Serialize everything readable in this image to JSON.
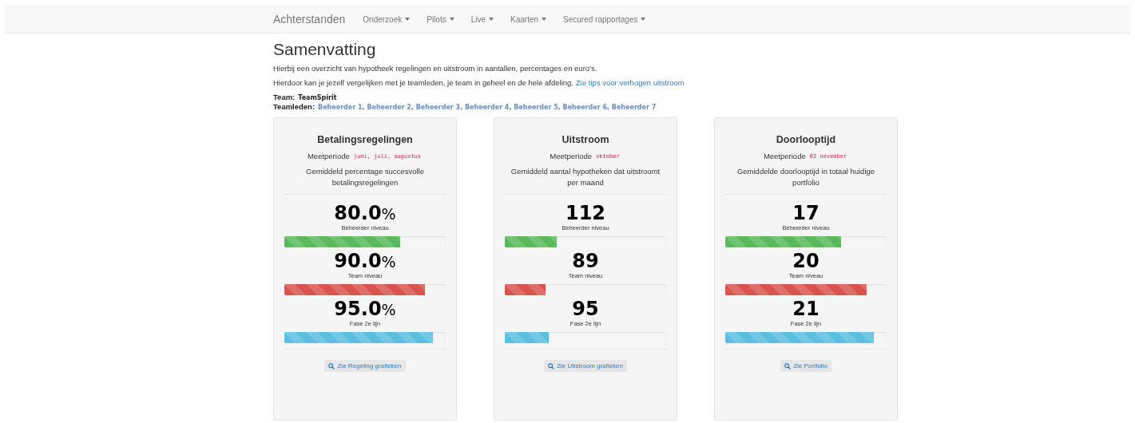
{
  "navbar": {
    "brand": "Achterstanden",
    "menus": [
      {
        "label": "Onderzoek"
      },
      {
        "label": "Pilots"
      },
      {
        "label": "Live"
      },
      {
        "label": "Kaarten"
      },
      {
        "label": "Secured rapportages"
      }
    ]
  },
  "heading": "Samenvatting",
  "intro": "Hierbij een overzicht van hypotheek regelingen en uitstroom in aantallen, percentages en euro's.",
  "compare": {
    "text": "Hierdoor kan je jezelf vergelijken met je teamleden, je team in geheel en de hele afdeling.",
    "link": "Zie tips voor verhogen uitstroom"
  },
  "team": {
    "label": "Team:",
    "value": "TeamSpirit"
  },
  "members": {
    "label": "Teamleden:",
    "value": "Beheerder 1, Beheerder 2, Beheerder 3, Beheerder 4, Beheerder 5, Beheerder 6, Beheerder 7"
  },
  "cards": [
    {
      "title": "Betalingsregelingen",
      "period_label": "Meetperiode",
      "period": "juni, juli, augustus",
      "description": "Gemiddeld percentage succesvolle betalingsregelingen",
      "metrics": [
        {
          "value": "80.0",
          "unit": "%",
          "label": "Beheerder niveau",
          "level": 0.72,
          "color": "#5cb85c"
        },
        {
          "value": "90.0",
          "unit": "%",
          "label": "Team niveau",
          "level": 0.87,
          "color": "#d9534f"
        },
        {
          "value": "95.0",
          "unit": "%",
          "label": "Fase 2e lijn",
          "level": 0.92,
          "color": "#5bc0de"
        }
      ],
      "button": "Zie Regeling grafieken"
    },
    {
      "title": "Uitstroom",
      "period_label": "Meetperiode",
      "period": "oktober",
      "description": "Gemiddeld aantal hypotheken dat uitstroomt per maand",
      "metrics": [
        {
          "value": "112",
          "label": "Beheerder niveau",
          "level": 0.32,
          "color": "#5cb85c"
        },
        {
          "value": "89",
          "label": "Team niveau",
          "level": 0.25,
          "color": "#d9534f"
        },
        {
          "value": "95",
          "label": "Fase 2e lijn",
          "level": 0.27,
          "color": "#5bc0de"
        }
      ],
      "button": "Zie Uitstroom grafieken"
    },
    {
      "title": "Doorlooptijd",
      "period_label": "Meetperiode",
      "period": "02 november",
      "description": "Gemiddelde doorlooptijd in totaal huidige portfolio",
      "metrics": [
        {
          "value": "17",
          "label": "Beheerder niveau",
          "level": 0.72,
          "color": "#5cb85c"
        },
        {
          "value": "20",
          "label": "Team niveau",
          "level": 0.875,
          "color": "#d9534f"
        },
        {
          "value": "21",
          "label": "Fase 2e lijn",
          "level": 0.92,
          "color": "#5bc0de"
        }
      ],
      "button": "Zie Portfolio"
    }
  ]
}
